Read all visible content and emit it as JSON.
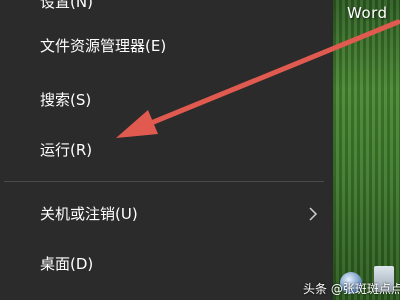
{
  "start_menu": {
    "items": [
      {
        "label": "设置(N)"
      },
      {
        "label": "文件资源管理器(E)"
      },
      {
        "label": "搜索(S)"
      },
      {
        "label": "运行(R)"
      },
      {
        "label": "关机或注销(U)"
      },
      {
        "label": "桌面(D)"
      }
    ]
  },
  "desktop": {
    "word_label": "Word"
  },
  "watermark": "头条 @张斑斑点点",
  "colors": {
    "menu_bg": "#2b2b2b",
    "arrow": "#e05a50",
    "wallpaper": "#3e7a2c"
  }
}
